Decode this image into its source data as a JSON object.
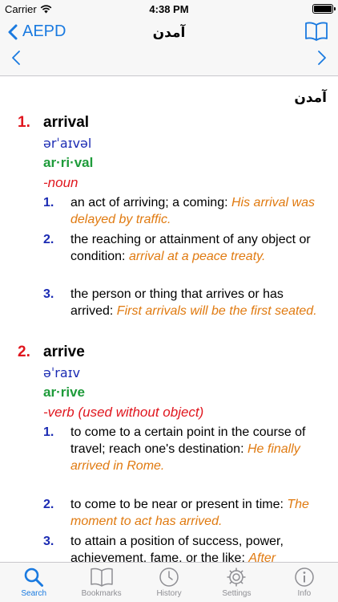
{
  "status_bar": {
    "carrier": "Carrier",
    "time": "4:38 PM"
  },
  "nav": {
    "back_label": "AEPD",
    "title": "آمدن"
  },
  "headword": "آمدن",
  "entries": [
    {
      "number": "1.",
      "word": "arrival",
      "pronunciation": "ərˈaɪvəl",
      "syllables": "ar·ri·val",
      "pos": "-noun",
      "senses": [
        {
          "number": "1.",
          "text": "an act of arriving; a coming: ",
          "example": "His arrival was delayed by traffic."
        },
        {
          "number": "2.",
          "text": "the reaching or attainment of any object or condition: ",
          "example": "arrival at a peace treaty."
        },
        {
          "number": "3.",
          "text": "the person or thing that arrives or has arrived: ",
          "example": "First arrivals will be the first seated."
        }
      ]
    },
    {
      "number": "2.",
      "word": "arrive",
      "pronunciation": "əˈraɪv",
      "syllables": "ar·rive",
      "pos": "-verb (used without object)",
      "senses": [
        {
          "number": "1.",
          "text": "to come to a certain point in the course of travel; reach one's destination: ",
          "example": "He finally arrived in Rome."
        },
        {
          "number": "2.",
          "text": "to come to be near or present in time: ",
          "example": "The moment to act has arrived."
        },
        {
          "number": "3.",
          "text": "to attain a position of success, power, achievement, fame, or the like: ",
          "example": "After"
        }
      ]
    }
  ],
  "tabs": [
    {
      "label": "Search",
      "icon": "search-icon"
    },
    {
      "label": "Bookmarks",
      "icon": "book-icon"
    },
    {
      "label": "History",
      "icon": "clock-icon"
    },
    {
      "label": "Settings",
      "icon": "gear-icon"
    },
    {
      "label": "Info",
      "icon": "info-icon"
    }
  ],
  "colors": {
    "accent": "#1a7ae0",
    "entry_number": "#e0161e",
    "pronunciation": "#1b2bb3",
    "syllables": "#1e9b3a",
    "example": "#e07a10",
    "inactive_tab": "#8e8e93"
  }
}
